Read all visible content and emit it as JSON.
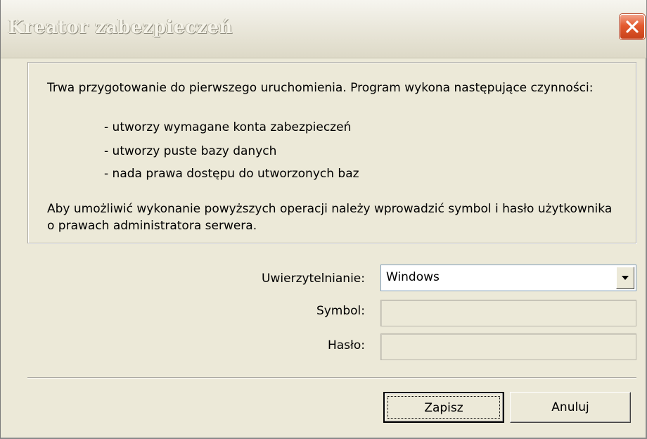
{
  "window": {
    "title": "Kreator zabezpieczeń"
  },
  "info": {
    "intro": "Trwa przygotowanie do pierwszego uruchomienia. Program wykona następujące czynności:",
    "bullets": [
      "- utworzy wymagane konta zabezpieczeń",
      "- utworzy puste bazy danych",
      "- nada prawa dostępu do utworzonych baz"
    ],
    "outro": "Aby umożliwić wykonanie powyższych operacji należy wprowadzić symbol i hasło użytkownika o prawach administratora serwera."
  },
  "form": {
    "auth_label": "Uwierzytelnianie:",
    "auth_value": "Windows",
    "symbol_label": "Symbol:",
    "symbol_value": "",
    "password_label": "Hasło:",
    "password_value": ""
  },
  "buttons": {
    "save": "Zapisz",
    "cancel": "Anuluj"
  },
  "icons": {
    "close": "close-icon",
    "dropdown": "chevron-down-icon"
  },
  "colors": {
    "window_bg": "#ECE9D8",
    "close_button": "#E45A2E"
  }
}
